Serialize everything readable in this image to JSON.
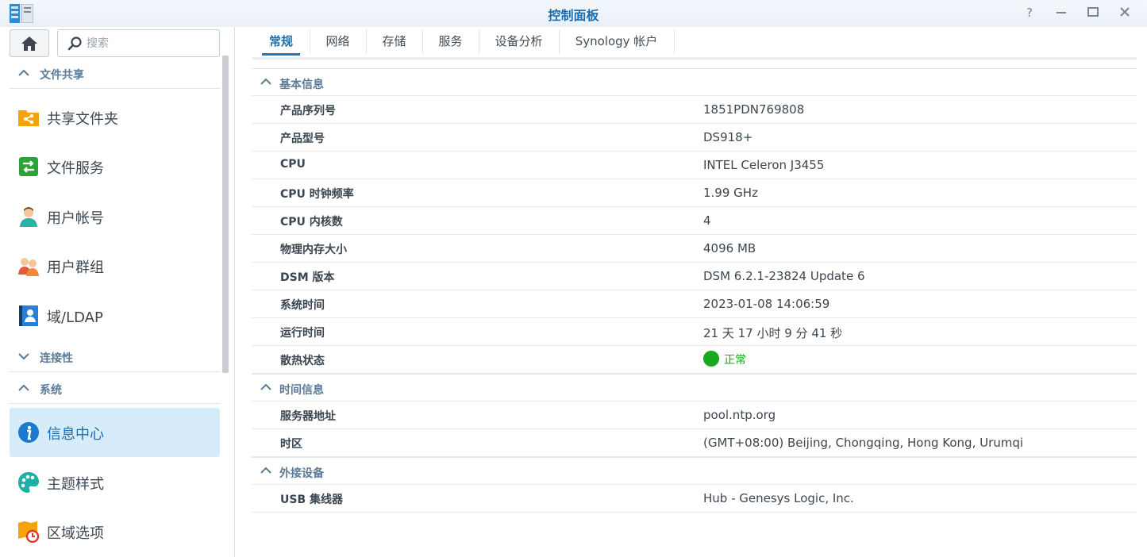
{
  "window": {
    "title": "控制面板"
  },
  "search": {
    "placeholder": "搜索"
  },
  "sidebar": {
    "sections": [
      {
        "label": "文件共享",
        "expanded": true
      },
      {
        "label": "连接性",
        "expanded": false
      },
      {
        "label": "系统",
        "expanded": true
      }
    ],
    "items": [
      {
        "label": "共享文件夹",
        "icon": "shared-folder-icon"
      },
      {
        "label": "文件服务",
        "icon": "file-services-icon"
      },
      {
        "label": "用户帐号",
        "icon": "user-icon"
      },
      {
        "label": "用户群组",
        "icon": "group-icon"
      },
      {
        "label": "域/LDAP",
        "icon": "domain-ldap-icon"
      },
      {
        "label": "信息中心",
        "icon": "info-icon",
        "active": true
      },
      {
        "label": "主题样式",
        "icon": "palette-icon"
      },
      {
        "label": "区域选项",
        "icon": "regional-options-icon"
      }
    ]
  },
  "tabs": [
    {
      "label": "常规",
      "active": true
    },
    {
      "label": "网络"
    },
    {
      "label": "存储"
    },
    {
      "label": "服务"
    },
    {
      "label": "设备分析"
    },
    {
      "label": "Synology 帐户"
    }
  ],
  "groups": {
    "basic": {
      "title": "基本信息",
      "rows": [
        {
          "key": "产品序列号",
          "value": "1851PDN769808"
        },
        {
          "key": "产品型号",
          "value": "DS918+"
        },
        {
          "key": "CPU",
          "value": "INTEL Celeron J3455"
        },
        {
          "key": "CPU 时钟频率",
          "value": "1.99 GHz"
        },
        {
          "key": "CPU 内核数",
          "value": "4"
        },
        {
          "key": "物理内存大小",
          "value": "4096 MB"
        },
        {
          "key": "DSM 版本",
          "value": "DSM 6.2.1-23824 Update 6"
        },
        {
          "key": "系统时间",
          "value": "2023-01-08 14:06:59"
        },
        {
          "key": "运行时间",
          "value": "21 天 17 小时 9 分 41 秒"
        },
        {
          "key": "散热状态",
          "value": "正常"
        }
      ]
    },
    "time": {
      "title": "时间信息",
      "rows": [
        {
          "key": "服务器地址",
          "value": "pool.ntp.org"
        },
        {
          "key": "时区",
          "value": "(GMT+08:00) Beijing, Chongqing, Hong Kong, Urumqi"
        }
      ]
    },
    "external": {
      "title": "外接设备",
      "rows": [
        {
          "key": "USB 集线器",
          "value": "Hub - Genesys Logic, Inc."
        }
      ]
    }
  },
  "colors": {
    "accent": "#1b6fb2",
    "status_ok": "#18a81b",
    "active_bg": "#d6ecfb"
  }
}
